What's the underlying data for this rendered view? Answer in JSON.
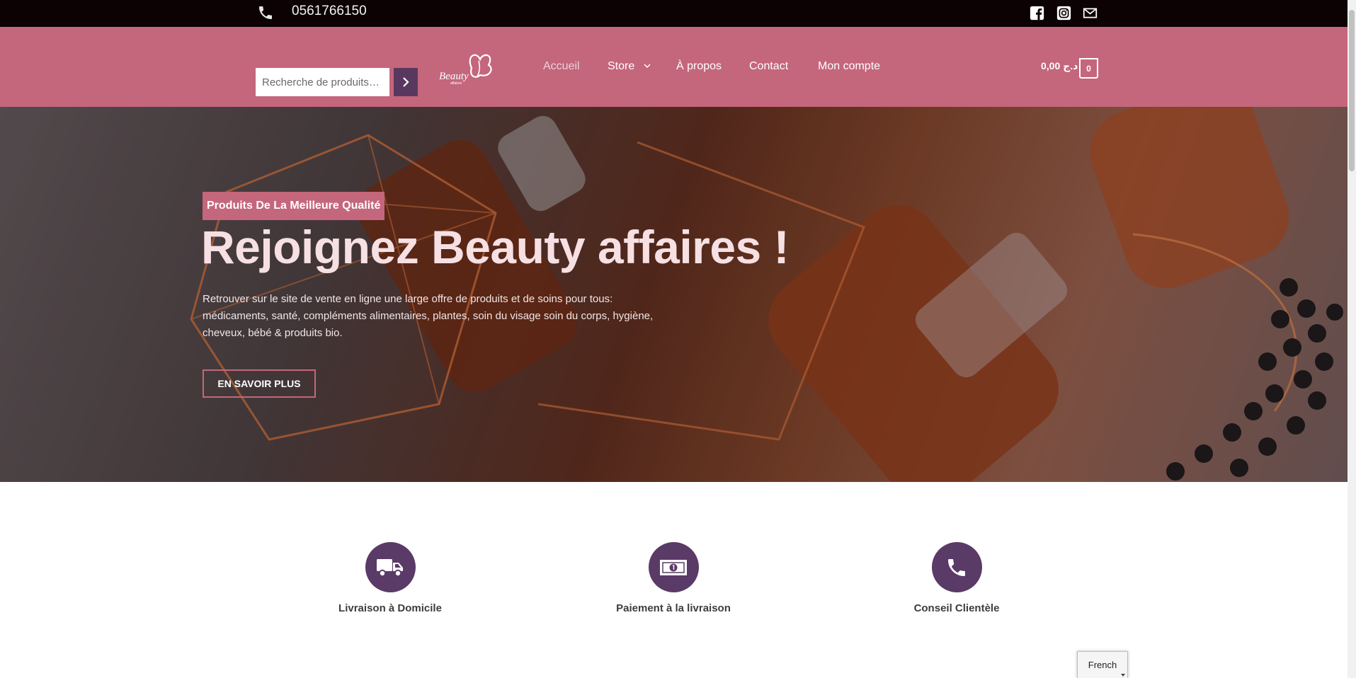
{
  "topbar": {
    "phone": "0561766150",
    "icons": [
      "phone-icon",
      "facebook-icon",
      "instagram-icon",
      "mail-icon"
    ]
  },
  "header": {
    "search": {
      "placeholder": "Recherche de produits…"
    },
    "logo": {
      "text": "Beauty",
      "subtext": "affaires"
    },
    "nav": [
      {
        "label": "Accueil",
        "active": true
      },
      {
        "label": "Store",
        "has_dropdown": true
      },
      {
        "label": "À propos"
      },
      {
        "label": "Contact"
      },
      {
        "label": "Mon compte"
      }
    ],
    "cart": {
      "total": "0,00 د.ج",
      "count": "0"
    }
  },
  "hero": {
    "badge": "Produits De La Meilleure Qualité",
    "title": "Rejoignez Beauty affaires !",
    "text": "Retrouver sur le site de vente en ligne une large offre de produits et de soins pour tous: médicaments, santé, compléments alimentaires, plantes, soin du visage soin du corps, hygiène, cheveux, bébé & produits bio.",
    "cta": "EN SAVOIR PLUS"
  },
  "features": [
    {
      "label": "Livraison à Domicile",
      "icon": "truck-icon"
    },
    {
      "label": "Paiement à la livraison",
      "icon": "money-icon"
    },
    {
      "label": "Conseil Clientèle",
      "icon": "phone-icon"
    }
  ],
  "language": {
    "selected": "French"
  },
  "colors": {
    "topbar": "#0d0203",
    "header": "#c4667c",
    "accent_purple": "#5a3a66",
    "search_button": "#59385f"
  }
}
